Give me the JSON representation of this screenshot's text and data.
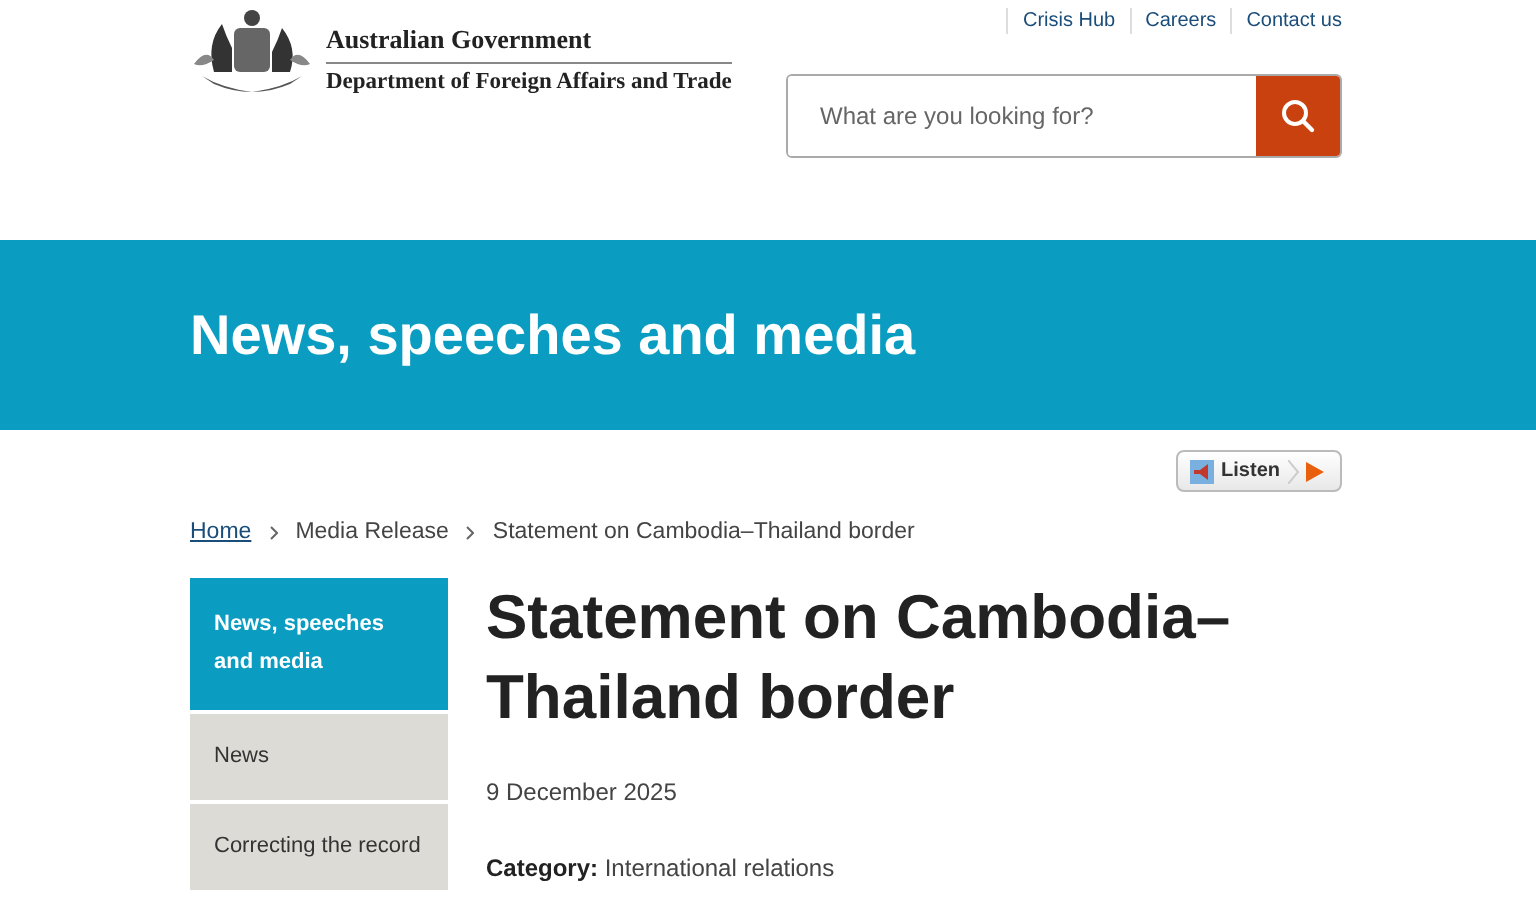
{
  "header": {
    "agency": "Australian Government",
    "department": "Department of Foreign Affairs and Trade",
    "utility_links": [
      "Crisis Hub",
      "Careers",
      "Contact us"
    ],
    "search": {
      "placeholder": "What are you looking for?"
    }
  },
  "banner": {
    "title": "News, speeches and media"
  },
  "listen_button": {
    "label": "Listen"
  },
  "breadcrumb": [
    {
      "label": "Home",
      "link": true
    },
    {
      "label": "Media Release",
      "link": false
    },
    {
      "label": "Statement on Cambodia–Thailand border",
      "link": false
    }
  ],
  "sidebar": {
    "items": [
      {
        "label": "News, speeches and media",
        "selected": true
      },
      {
        "label": "News",
        "selected": false
      },
      {
        "label": "Correcting the record",
        "selected": false
      }
    ]
  },
  "article": {
    "title": "Statement on Cambodia–Thailand border",
    "date": "9 December 2025",
    "category": "**Category:** International relations"
  }
}
